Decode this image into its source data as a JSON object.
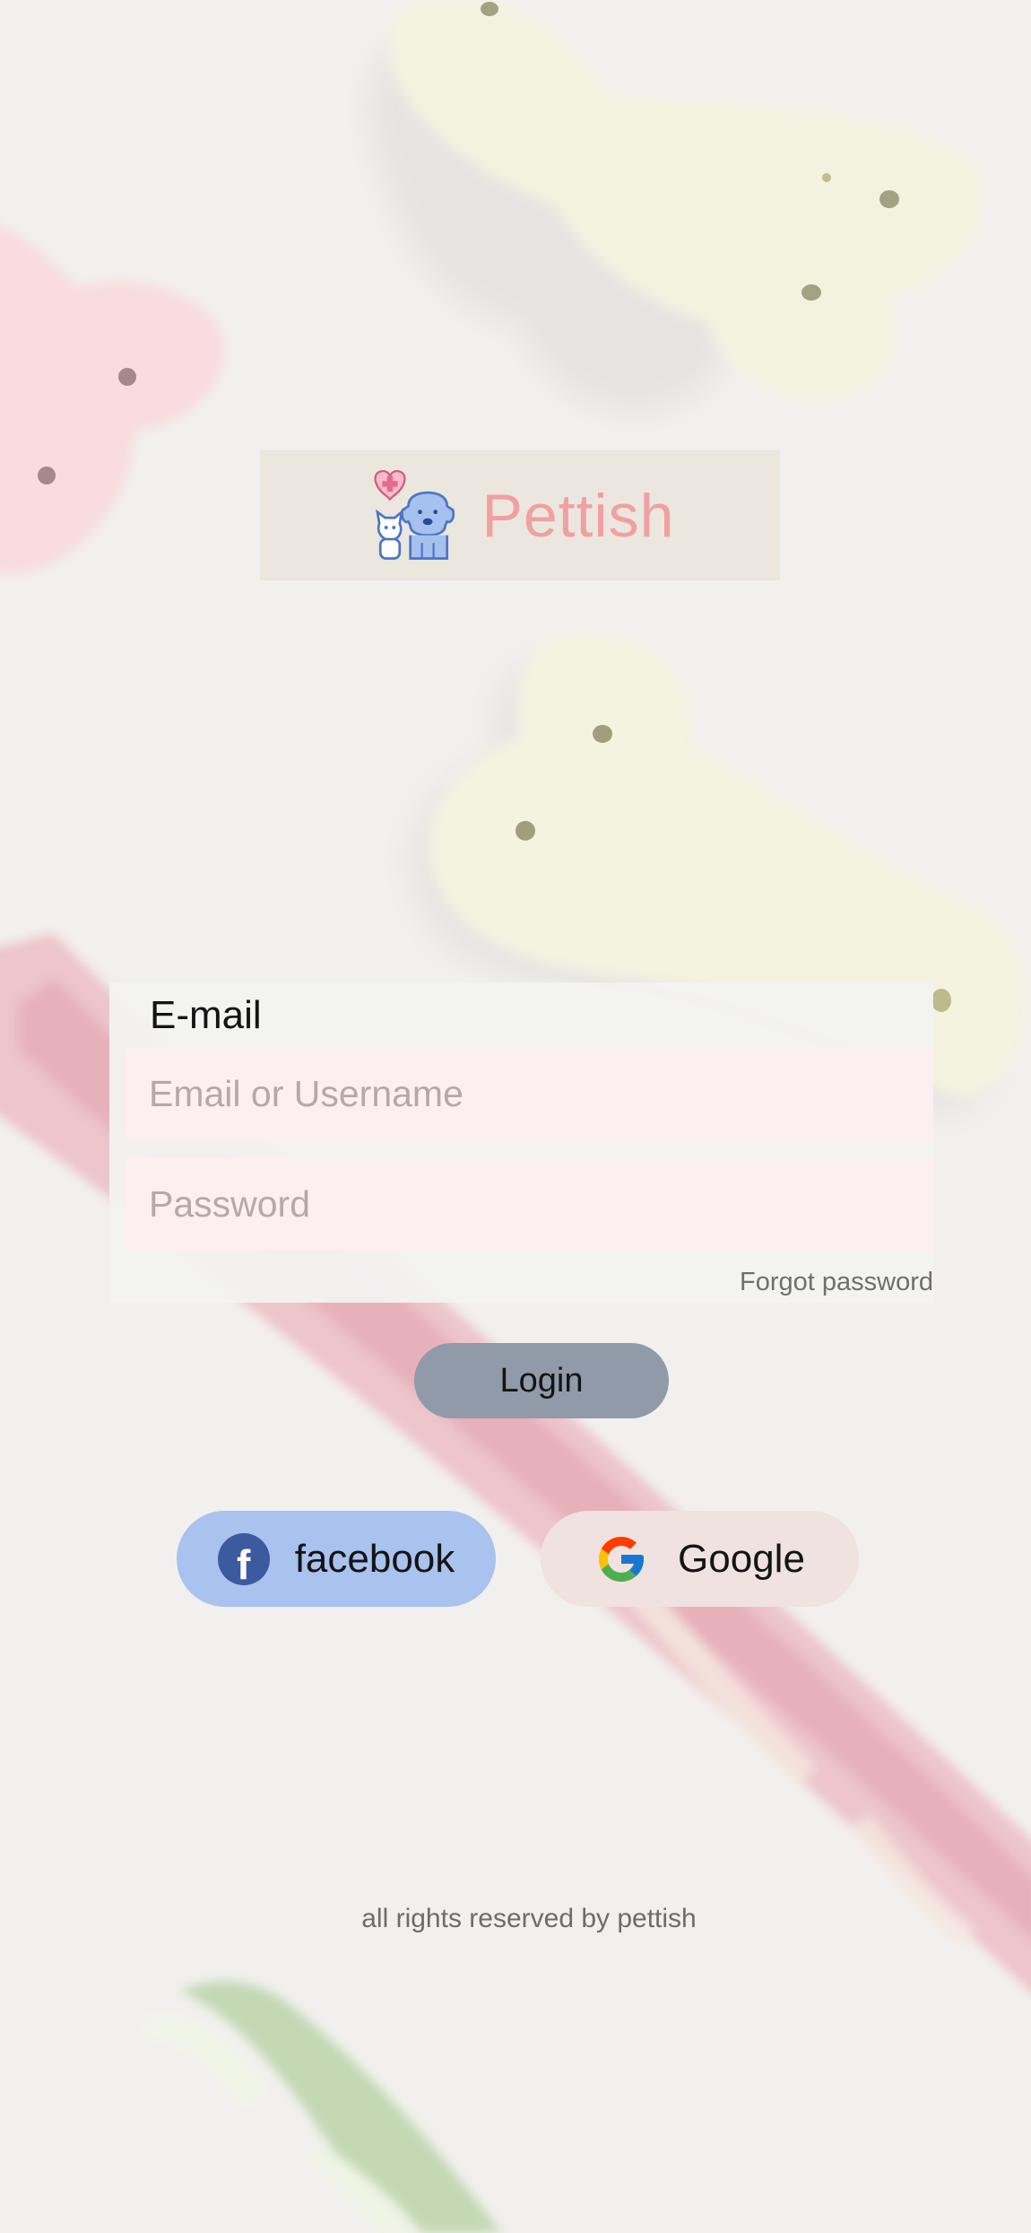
{
  "brand": {
    "name": "Pettish",
    "logo_icon": "pet-care-logo-icon",
    "accent_color": "#f0a0a3"
  },
  "form": {
    "heading": "E-mail",
    "email": {
      "value": "",
      "placeholder": "Email or Username"
    },
    "password": {
      "value": "",
      "placeholder": "Password"
    },
    "forgot_password": "Forgot password"
  },
  "login_button": {
    "label": "Login",
    "color": "#919aa8"
  },
  "social": {
    "facebook": {
      "label": "facebook",
      "icon": "facebook-icon",
      "color": "#a9c2ee"
    },
    "google": {
      "label": "Google",
      "icon": "google-icon",
      "color": "#efe2e1"
    }
  },
  "footer": {
    "text": "all rights reserved by pettish"
  }
}
